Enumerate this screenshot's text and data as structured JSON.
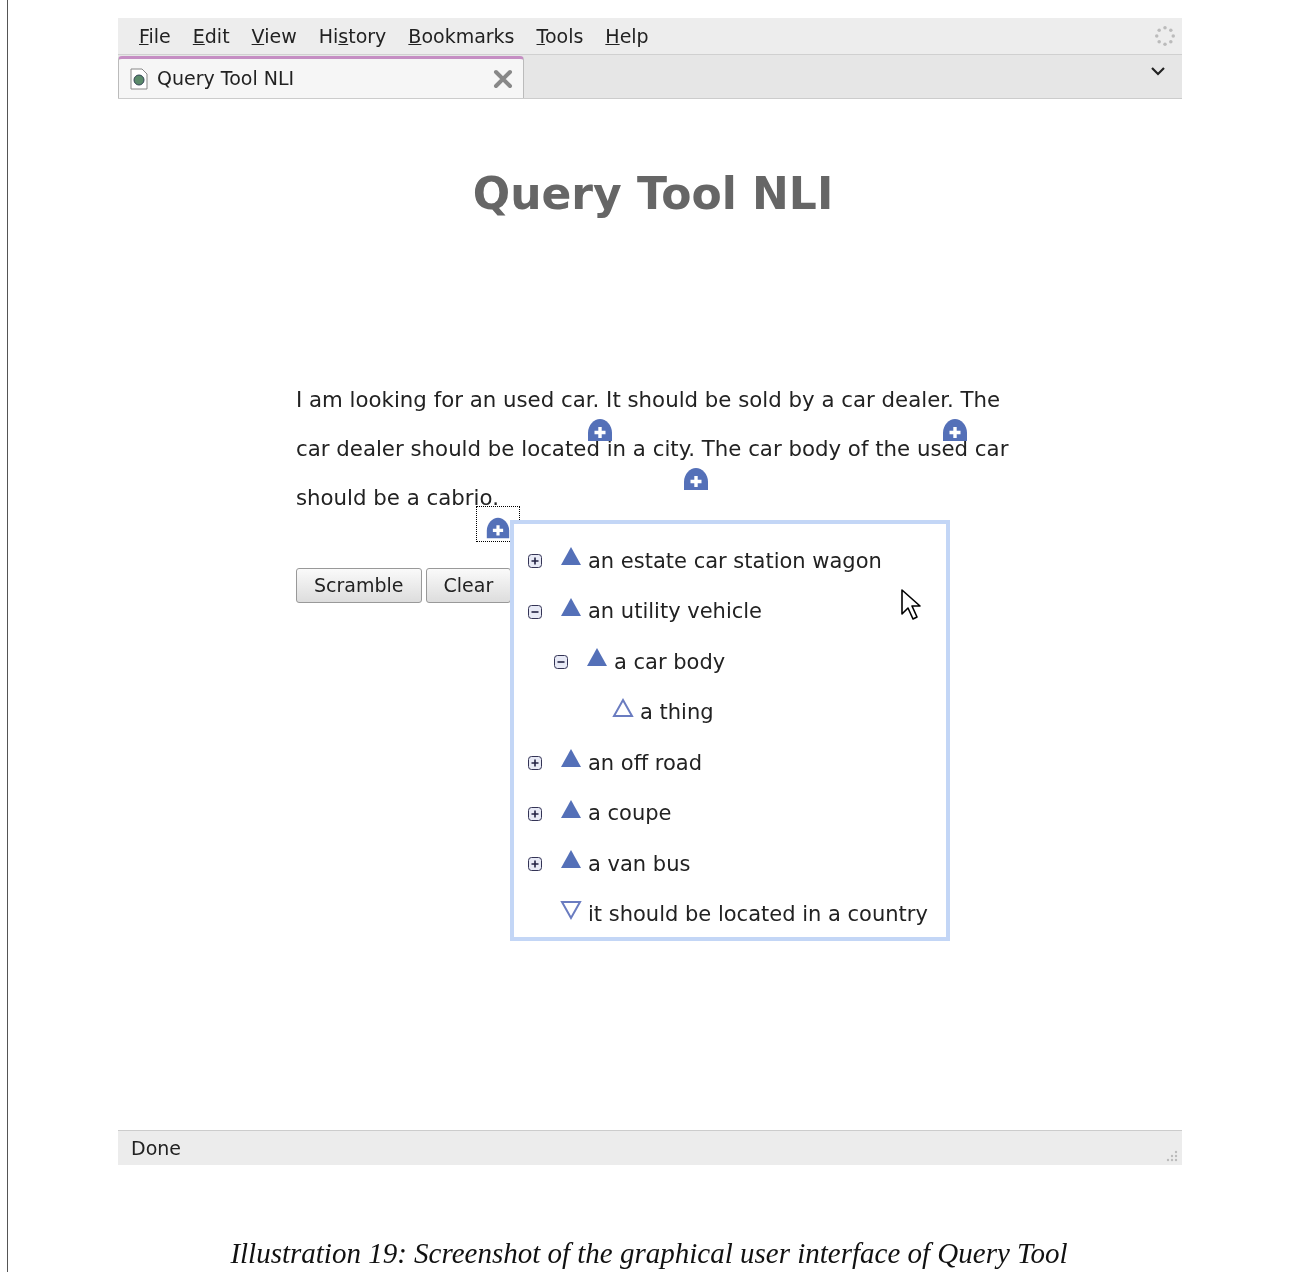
{
  "menu": [
    {
      "accesskey": "F",
      "rest": "ile"
    },
    {
      "accesskey": "E",
      "rest": "dit"
    },
    {
      "accesskey": "V",
      "rest": "iew"
    },
    {
      "start": "Hi",
      "accesskey": "s",
      "rest": "tory"
    },
    {
      "accesskey": "B",
      "rest": "ookmarks"
    },
    {
      "accesskey": "T",
      "rest": "ools"
    },
    {
      "accesskey": "H",
      "rest": "elp"
    }
  ],
  "tabs": [
    {
      "label": "Query Tool NLI",
      "selected": true
    }
  ],
  "page": {
    "heading": "Query Tool NLI",
    "lines": [
      {
        "segments": [
          {
            "text": "I am looking for an used car.",
            "marker": {
              "focused": false
            }
          },
          {
            "text": "It should be sold by a car dealer.",
            "marker": {
              "focused": false
            }
          },
          {
            "text": "The"
          }
        ]
      },
      {
        "segments": [
          {
            "text": "car dealer should be located in a city.",
            "marker": {
              "focused": false
            }
          },
          {
            "text": "The car body of the used car"
          }
        ]
      },
      {
        "segments": [
          {
            "text": "should be a cabrio.",
            "marker": {
              "focused": true
            }
          }
        ]
      }
    ],
    "buttons": [
      "Scramble",
      "Clear"
    ],
    "suggestions": [
      {
        "label": "an estate car station wagon",
        "kind": "node",
        "expanded": false
      },
      {
        "label": "an utility vehicle",
        "kind": "node",
        "expanded": true,
        "children": [
          {
            "label": "a car body",
            "kind": "node",
            "expanded": true,
            "children": [
              {
                "label": "a thing",
                "kind": "leaf"
              }
            ]
          }
        ]
      },
      {
        "label": "an off road",
        "kind": "node",
        "expanded": false
      },
      {
        "label": "a coupe",
        "kind": "node",
        "expanded": false
      },
      {
        "label": "a van bus",
        "kind": "node",
        "expanded": false
      },
      {
        "label": "it should be located in a country",
        "kind": "reverse"
      }
    ]
  },
  "status_bar": "Done",
  "caption": "Illustration 19: Screenshot of the graphical user interface of Query Tool"
}
